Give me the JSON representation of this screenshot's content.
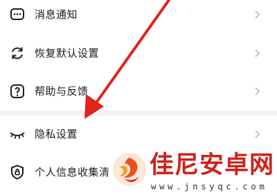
{
  "settings": {
    "items": [
      {
        "label": "消息通知",
        "icon": "message-icon"
      },
      {
        "label": "恢复默认设置",
        "icon": "refresh-icon"
      },
      {
        "label": "帮助与反馈",
        "icon": "help-icon"
      },
      {
        "label": "隐私设置",
        "icon": "eye-closed-icon"
      },
      {
        "label": "个人信息收集清",
        "icon": "shield-icon"
      }
    ]
  },
  "annotation": {
    "arrow_color": "#e0231b",
    "icon": "red-arrow-icon"
  },
  "watermark": {
    "name": "佳尼安卓网",
    "url": "www.jnsyqc.com",
    "color": "#d0211b",
    "icon": "phoenix-logo-icon"
  }
}
